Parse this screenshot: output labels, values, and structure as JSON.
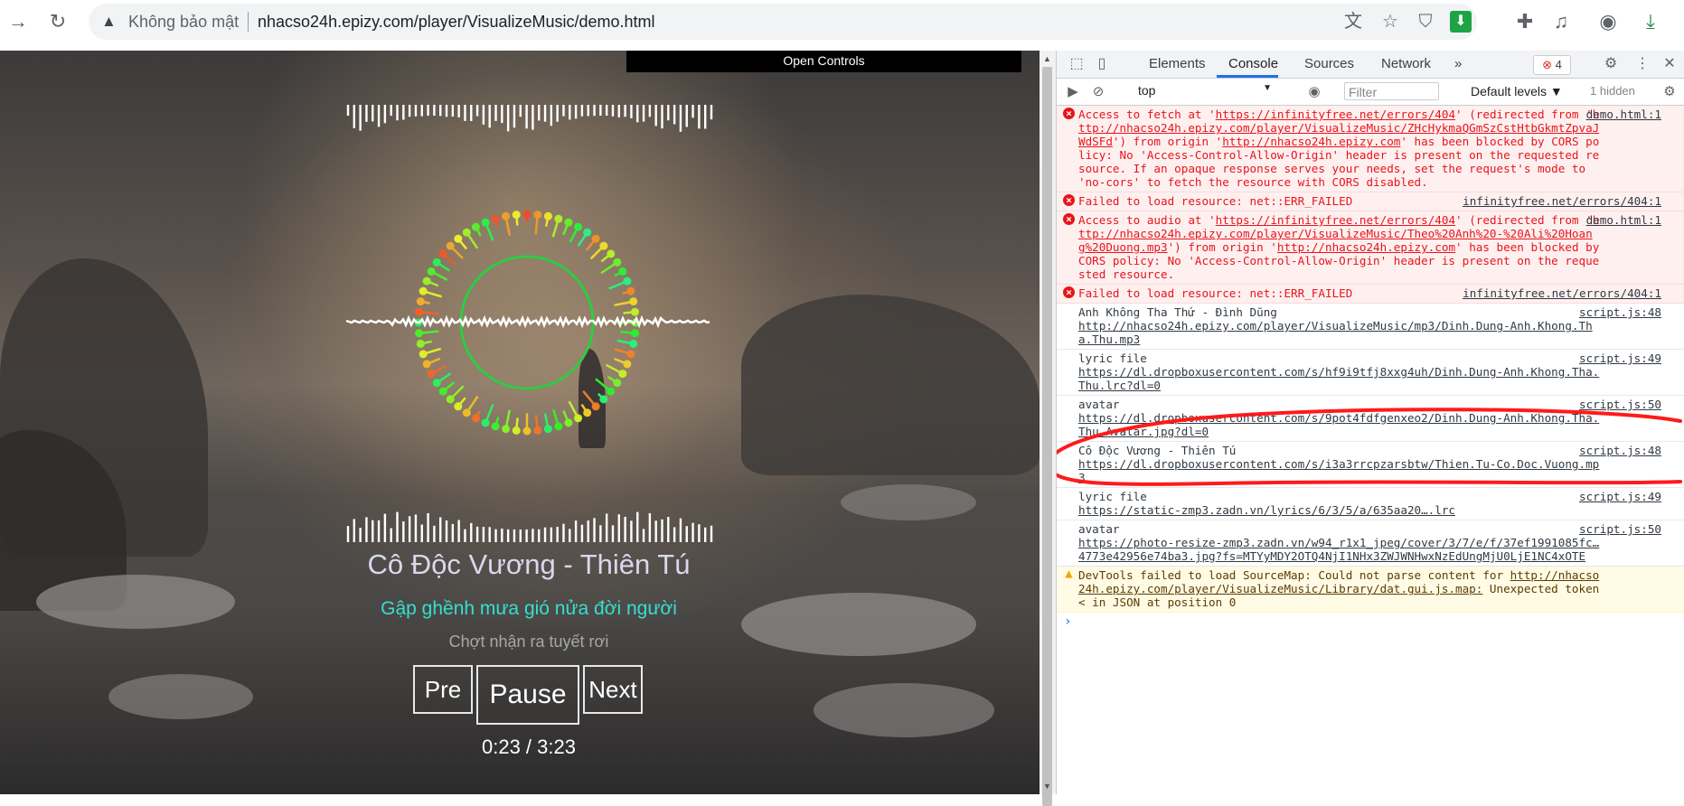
{
  "browser": {
    "security_label": "Không bảo mật",
    "url": "nhacso24h.epizy.com/player/VisualizeMusic/demo.html",
    "icons": {
      "back": "arrow-right-icon",
      "reload": "reload-icon",
      "translate": "translate-icon",
      "bookmark": "star-icon",
      "shield": "shield-icon",
      "download_ext": "download-arrow-icon",
      "extensions": "puzzle-icon",
      "media": "media-queue-icon",
      "profile": "profile-icon",
      "downloads": "downloads-icon"
    },
    "colors": {
      "download_ext": "#1ea446",
      "downloads": "#1e8e3e"
    }
  },
  "player": {
    "open_controls": "Open Controls",
    "song_title": "Cô Độc Vương - Thiên Tú",
    "lyric_current": "Gập ghềnh mưa gió nửa đời người",
    "lyric_next": "Chợt nhận ra tuyết rơi",
    "buttons": {
      "pre": "Pre",
      "pause": "Pause",
      "next": "Next"
    },
    "time": "0:23 / 3:23",
    "colors": {
      "lyric_current": "#34e0cf",
      "ring": "#2ecc40",
      "title": "#d8d8ee"
    }
  },
  "devtools": {
    "tabs": [
      "Elements",
      "Console",
      "Sources",
      "Network"
    ],
    "active_tab": "Console",
    "more_tabs": "»",
    "error_count": "4",
    "context": "top",
    "filter_placeholder": "Filter",
    "levels": "Default levels ▼",
    "hidden": "1 hidden",
    "messages": [
      {
        "level": "error",
        "text": "Access to fetch at 'https://infinityfree.net/errors/404' (redirected from 'http://nhacso24h.epizy.com/player/VisualizeMusic/ZHcHykmaQGmSzCstHtbGkmtZpvaJWdSFd') from origin 'http://nhacso24h.epizy.com' has been blocked by CORS policy: No 'Access-Control-Allow-Origin' header is present on the requested resource. If an opaque response serves your needs, set the request's mode to 'no-cors' to fetch the resource with CORS disabled.",
        "source": "demo.html:1"
      },
      {
        "level": "error",
        "text": "Failed to load resource: net::ERR_FAILED",
        "source": "infinityfree.net/errors/404:1"
      },
      {
        "level": "error",
        "text": "Access to audio at 'https://infinityfree.net/errors/404' (redirected from 'http://nhacso24h.epizy.com/player/VisualizeMusic/Theo%20Anh%20-%20Ali%20Hoang%20Duong.mp3') from origin 'http://nhacso24h.epizy.com' has been blocked by CORS policy: No 'Access-Control-Allow-Origin' header is present on the requested resource.",
        "source": "demo.html:1"
      },
      {
        "level": "error",
        "text": "Failed to load resource: net::ERR_FAILED",
        "source": "infinityfree.net/errors/404:1"
      },
      {
        "level": "log",
        "text": "Anh Không Tha Thứ - Đình Dũng\nhttp://nhacso24h.epizy.com/player/VisualizeMusic/mp3/Dinh.Dung-Anh.Khong.Tha.Thu.mp3",
        "source": "script.js:48"
      },
      {
        "level": "log",
        "text": "lyric file\nhttps://dl.dropboxusercontent.com/s/hf9i9tfj8xxg4uh/Dinh.Dung-Anh.Khong.Tha.Thu.lrc?dl=0",
        "source": "script.js:49"
      },
      {
        "level": "log",
        "text": "avatar\nhttps://dl.dropboxusercontent.com/s/9pot4fdfgenxeo2/Dinh.Dung-Anh.Khong.Tha.Thu.Avatar.jpg?dl=0",
        "source": "script.js:50"
      },
      {
        "level": "log",
        "text": "Cô Độc Vương - Thiên Tú\nhttps://dl.dropboxusercontent.com/s/i3a3rrcpzarsbtw/Thien.Tu-Co.Doc.Vuong.mp3",
        "source": "script.js:48"
      },
      {
        "level": "log",
        "text": "lyric file\nhttps://static-zmp3.zadn.vn/lyrics/6/3/5/a/635aa20….lrc",
        "source": "script.js:49"
      },
      {
        "level": "log",
        "text": "avatar\nhttps://photo-resize-zmp3.zadn.vn/w94_r1x1_jpeg/cover/3/7/e/f/37ef1991085fc…4773e42956e74ba3.jpg?fs=MTYyMDY2OTQ4NjI1NHx3ZWJWNHwxNzEdUngMjU0LjE1NC4xOTE",
        "source": "script.js:50"
      },
      {
        "level": "warning",
        "text": "DevTools failed to load SourceMap: Could not parse content for http://nhacso24h.epizy.com/player/VisualizeMusic/Library/dat.gui.js.map: Unexpected token < in JSON at position 0",
        "source": ""
      }
    ],
    "prompt": "›",
    "colors": {
      "error": "#e8141a",
      "tab_active": "#1a73e8",
      "annotation": "#ff1a1a"
    }
  }
}
